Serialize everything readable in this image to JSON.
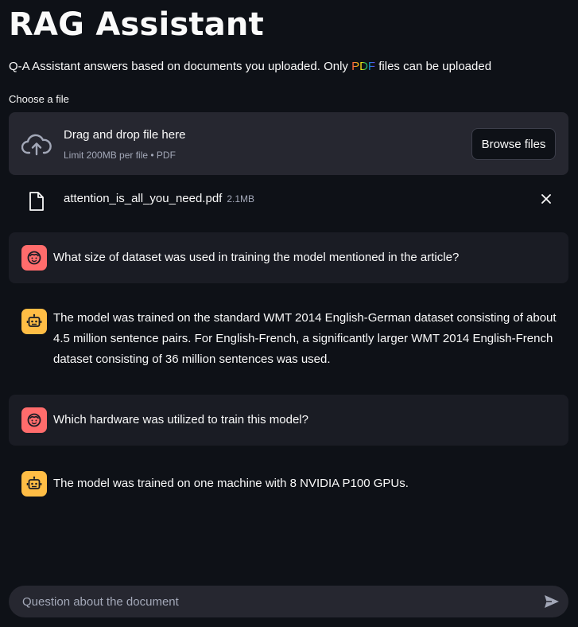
{
  "header": {
    "title": "RAG Assistant",
    "subtitle_before": "Q-A Assistant answers based on documents you uploaded. Only ",
    "subtitle_highlight": "PDF",
    "subtitle_after": " files can be uploaded"
  },
  "uploader": {
    "label": "Choose a file",
    "drag_text": "Drag and drop file here",
    "limit_text": "Limit 200MB per file • PDF",
    "browse_label": "Browse files",
    "icon": "cloud-upload-icon"
  },
  "uploaded_file": {
    "name": "attention_is_all_you_need.pdf",
    "size": "2.1MB",
    "icon": "file-icon"
  },
  "messages": [
    {
      "role": "user",
      "text": "What size of dataset was used in training the model mentioned in the article?"
    },
    {
      "role": "assistant",
      "text": "The model was trained on the standard WMT 2014 English-German dataset consisting of about 4.5 million sentence pairs. For English-French, a significantly larger WMT 2014 English-French dataset consisting of 36 million sentences was used."
    },
    {
      "role": "user",
      "text": "Which hardware was utilized to train this model?"
    },
    {
      "role": "assistant",
      "text": "The model was trained on one machine with 8 NVIDIA P100 GPUs."
    }
  ],
  "chat_input": {
    "placeholder": "Question about the document"
  },
  "colors": {
    "background": "#0e1117",
    "surface": "#262730",
    "user_avatar": "#ff6c6c",
    "assistant_avatar": "#ffbd45"
  }
}
